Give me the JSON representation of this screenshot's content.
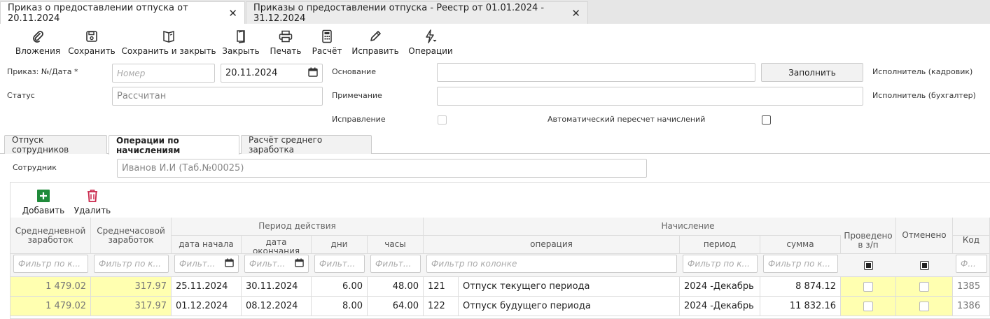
{
  "window_tabs": [
    {
      "label": "Приказ о предоставлении отпуска от 20.11.2024",
      "active": true
    },
    {
      "label": "Приказы о предоставлении отпуска - Реестр от 01.01.2024 - 31.12.2024",
      "active": false
    }
  ],
  "toolbar": {
    "attachments": "Вложения",
    "save": "Сохранить",
    "save_close": "Сохранить и закрыть",
    "close": "Закрыть",
    "print": "Печать",
    "calc": "Расчёт",
    "edit": "Исправить",
    "operations": "Операции"
  },
  "form": {
    "order_label": "Приказ: №/Дата *",
    "number_placeholder": "Номер",
    "date_value": "20.11.2024",
    "status_label": "Статус",
    "status_value": "Рассчитан",
    "basis_label": "Основание",
    "note_label": "Примечание",
    "correction_label": "Исправление",
    "auto_recalc_label": "Автоматический пересчет начислений",
    "fill_button": "Заполнить",
    "executor_hr": "Исполнитель (кадровик)",
    "executor_acc": "Исполнитель (бухгалтер)"
  },
  "content_tabs": [
    {
      "label": "Отпуск сотрудников",
      "active": false
    },
    {
      "label": "Операции по начислениям",
      "active": true
    },
    {
      "label": "Расчёт среднего заработка",
      "active": false
    }
  ],
  "employee": {
    "label": "Сотрудник",
    "value": "Иванов И.И (Таб.№00025)"
  },
  "grid_toolbar": {
    "add": "Добавить",
    "delete": "Удалить"
  },
  "table": {
    "group_period": "Период действия",
    "group_accrual": "Начисление",
    "columns": {
      "avg_daily": "Среднедневной заработок",
      "avg_hourly": "Среднечасовой заработок",
      "date_start": "дата начала",
      "date_end": "дата окончания",
      "days": "дни",
      "hours": "часы",
      "operation": "операция",
      "period": "период",
      "sum": "сумма",
      "posted": "Проведено в з/п",
      "cancelled": "Отменено",
      "code": "Код"
    },
    "filters": {
      "f1": "Фильтр по к...",
      "f2": "Фильтр по к...",
      "f3": "Фильт...",
      "f4": "Фильт...",
      "f5": "Фильт...",
      "f6": "Фильт...",
      "f7": "Фильтр по колонке",
      "f8": "Фильтр по к...",
      "f9": "Фильтр по к...",
      "f10": "Ф..."
    },
    "rows": [
      {
        "avg_daily": "1 479.02",
        "avg_hourly": "317.97",
        "date_start": "25.11.2024",
        "date_end": "30.11.2024",
        "days": "6.00",
        "hours": "48.00",
        "op_code": "121",
        "op_name": "Отпуск текущего периода",
        "period": "2024 -Декабрь",
        "sum": "8 874.12",
        "code": "1385"
      },
      {
        "avg_daily": "1 479.02",
        "avg_hourly": "317.97",
        "date_start": "01.12.2024",
        "date_end": "08.12.2024",
        "days": "8.00",
        "hours": "64.00",
        "op_code": "122",
        "op_name": "Отпуск будущего периода",
        "period": "2024 -Декабрь",
        "sum": "11 832.16",
        "code": "1386"
      }
    ]
  }
}
